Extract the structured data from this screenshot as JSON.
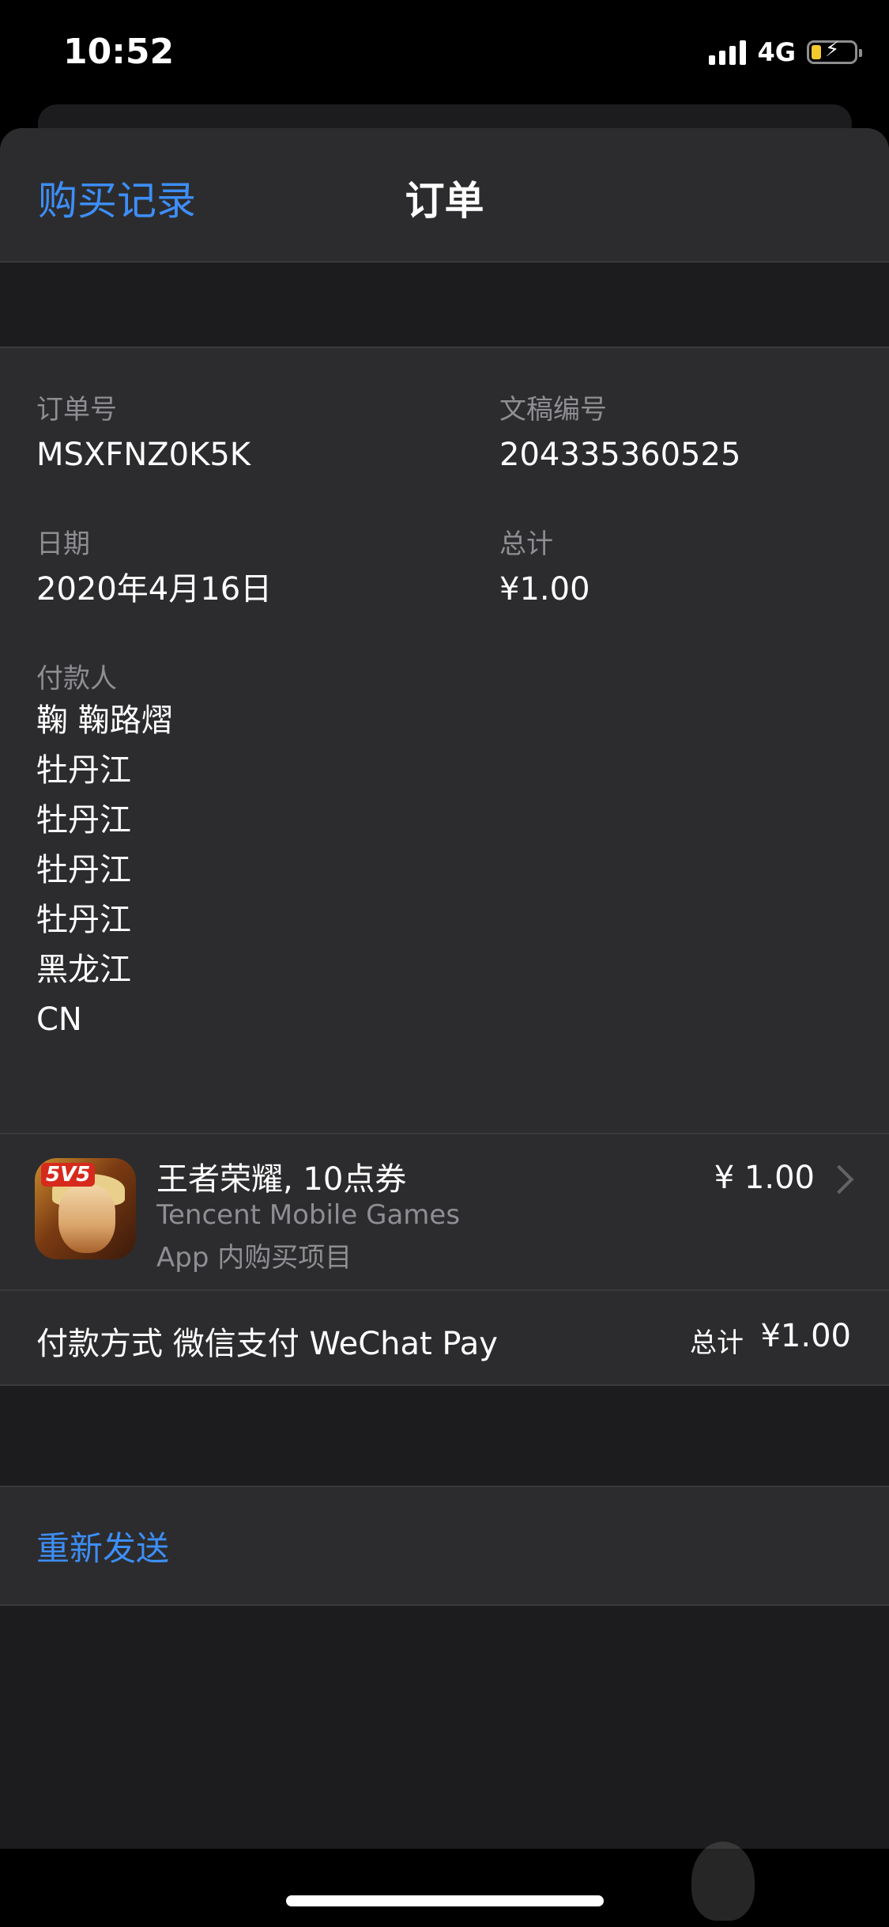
{
  "status": {
    "time": "10:52",
    "network": "4G"
  },
  "nav": {
    "back_label": "购买记录",
    "title": "订单"
  },
  "order": {
    "order_id_label": "订单号",
    "order_id": "MSXFNZ0K5K",
    "doc_label": "文稿编号",
    "doc_number": "204335360525",
    "date_label": "日期",
    "date": "2020年4月16日",
    "total_label": "总计",
    "total": "¥1.00",
    "payer_label": "付款人",
    "payer_lines": [
      "鞠 鞠路熠",
      "牡丹江",
      "牡丹江",
      "牡丹江",
      "牡丹江",
      "黑龙江",
      "CN"
    ]
  },
  "item": {
    "icon": "honor-of-kings-app-icon",
    "icon_badge": "5V5",
    "title": "王者荣耀, 10点券",
    "developer": "Tencent Mobile Games",
    "type": "App 内购买项目",
    "price": "¥ 1.00"
  },
  "payment": {
    "method": "付款方式 微信支付 WeChat Pay",
    "total_label": "总计",
    "total": "¥1.00"
  },
  "actions": {
    "resend": "重新发送"
  },
  "colors": {
    "accent": "#3d8ef7",
    "sheet": "#2c2c2e",
    "background": "#1c1c1e"
  }
}
